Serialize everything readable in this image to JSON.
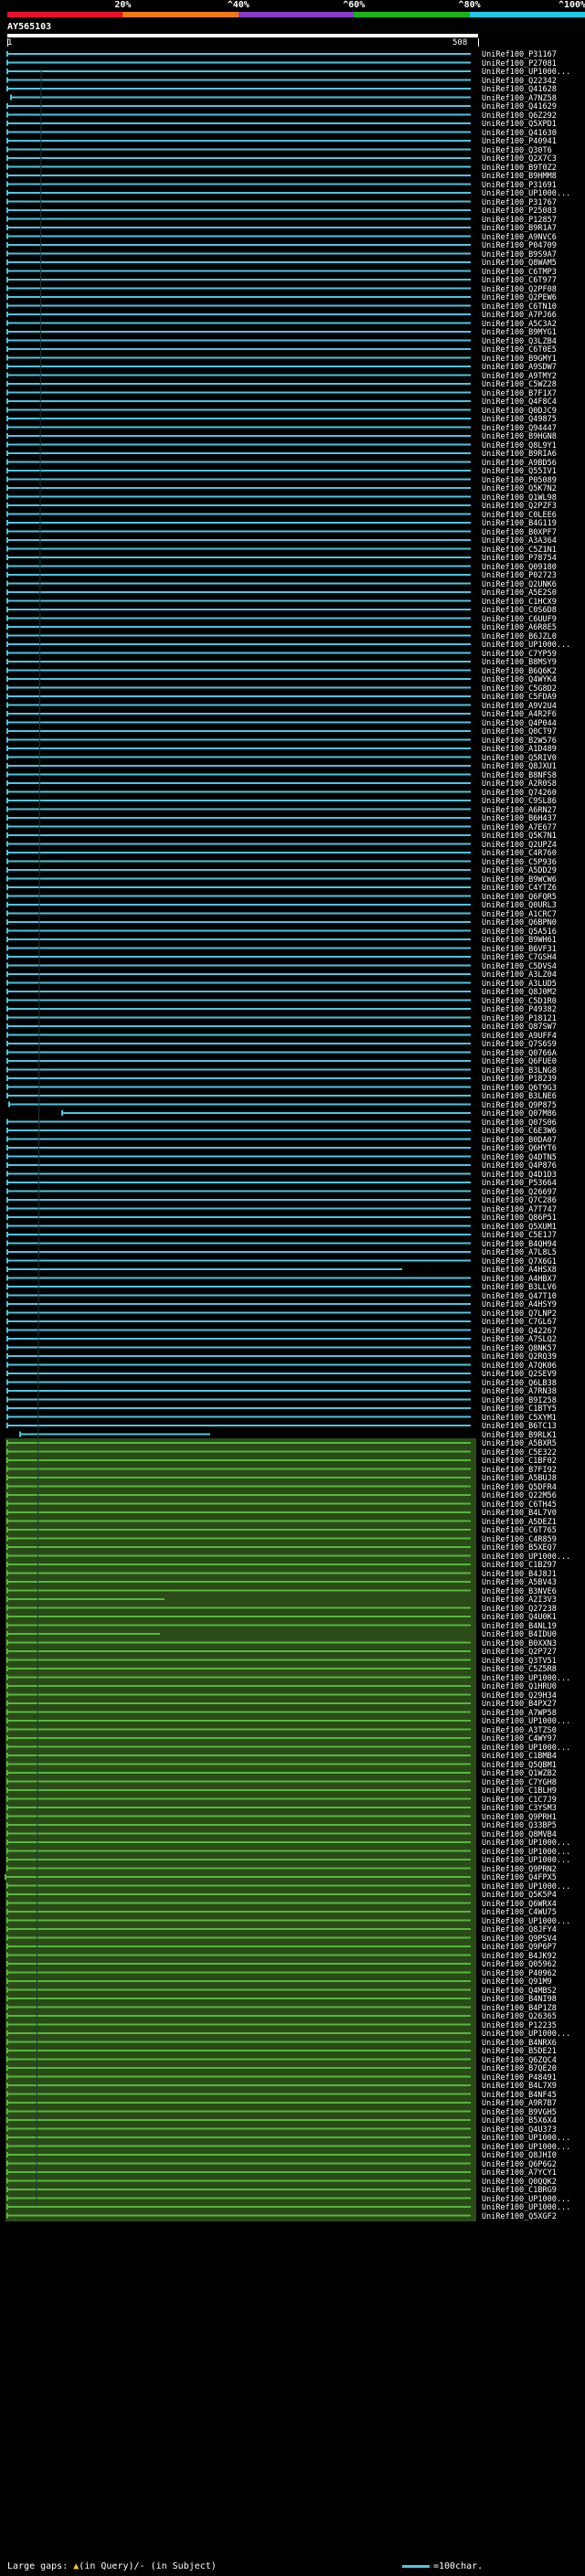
{
  "legend": {
    "labels": [
      "20%",
      "^40%",
      "^60%",
      "^80%",
      "^100%"
    ],
    "colors": [
      "#e8102a",
      "#f07a10",
      "#8a3cc8",
      "#18b418",
      "#1ec8e6"
    ]
  },
  "query": {
    "title": "AY565103",
    "ruler_start": "1",
    "ruler_end": "508"
  },
  "colors": {
    "cyan_hit": "#4ac6e0",
    "green_hit": "#56b83c",
    "green_bg": "#2a4a18",
    "gap_mark": "#ffd000"
  },
  "hits": [
    "UniRef100_P31167",
    "UniRef100_P27081",
    "UniRef100_UP1000...",
    "UniRef100_Q22342",
    "UniRef100_Q41628",
    "UniRef100_A7NZ58",
    "UniRef100_Q41629",
    "UniRef100_Q6Z292",
    "UniRef100_Q5XPD1",
    "UniRef100_Q41630",
    "UniRef100_P40941",
    "UniRef100_Q30T6",
    "UniRef100_Q2X7C3",
    "UniRef100_B9T0Z2",
    "UniRef100_B9HMM8",
    "UniRef100_P31691",
    "UniRef100_UP1000...",
    "UniRef100_P31767",
    "UniRef100_P25083",
    "UniRef100_P12857",
    "UniRef100_B9R1A7",
    "UniRef100_A9NVC6",
    "UniRef100_P04709",
    "UniRef100_B9S9A7",
    "UniRef100_Q8WAM5",
    "UniRef100_C6TMP3",
    "UniRef100_C6T977",
    "UniRef100_Q2PF08",
    "UniRef100_Q2PEW6",
    "UniRef100_C6TN10",
    "UniRef100_A7PJ66",
    "UniRef100_A5C3A2",
    "UniRef100_B9MYG1",
    "UniRef100_Q3LZB4",
    "UniRef100_C6T0E5",
    "UniRef100_B9GMY1",
    "UniRef100_A9SDW7",
    "UniRef100_A9TMY2",
    "UniRef100_C5WZ28",
    "UniRef100_B7F1X7",
    "UniRef100_Q4F8C4",
    "UniRef100_Q0DJC9",
    "UniRef100_Q49875",
    "UniRef100_Q94447",
    "UniRef100_B9HGN8",
    "UniRef100_Q8L9Y1",
    "UniRef100_B9RIA6",
    "UniRef100_A9BD56",
    "UniRef100_Q55IV1",
    "UniRef100_P05089",
    "UniRef100_Q5K7N2",
    "UniRef100_Q1WL98",
    "UniRef100_Q2PZF3",
    "UniRef100_C0LEE6",
    "UniRef100_B4G119",
    "UniRef100_B0XPF7",
    "UniRef100_A3A364",
    "UniRef100_C5Z1N1",
    "UniRef100_P78754",
    "UniRef100_Q09180",
    "UniRef100_P02723",
    "UniRef100_Q2UNK6",
    "UniRef100_A5E2S0",
    "UniRef100_C1HCX9",
    "UniRef100_C0S6D8",
    "UniRef100_C6UUF9",
    "UniRef100_A6R8E5",
    "UniRef100_B6JZL0",
    "UniRef100_UP1000...",
    "UniRef100_C7YP59",
    "UniRef100_B8MSY9",
    "UniRef100_B6Q6K2",
    "UniRef100_Q4WYK4",
    "UniRef100_C5G8D2",
    "UniRef100_C5FDA9",
    "UniRef100_A9V2U4",
    "UniRef100_A4R2F6",
    "UniRef100_Q4P044",
    "UniRef100_Q0CT97",
    "UniRef100_B2W576",
    "UniRef100_A1D489",
    "UniRef100_Q5RIV0",
    "UniRef100_Q8JXU1",
    "UniRef100_B8NFS8",
    "UniRef100_A2R0S8",
    "UniRef100_Q74260",
    "UniRef100_C9SL86",
    "UniRef100_A6RN27",
    "UniRef100_B6H437",
    "UniRef100_A7E677",
    "UniRef100_Q5K7N1",
    "UniRef100_Q2UPZ4",
    "UniRef100_C4R760",
    "UniRef100_C5P936",
    "UniRef100_A5DD29",
    "UniRef100_B9WCW6",
    "UniRef100_C4YTZ6",
    "UniRef100_Q6FQR5",
    "UniRef100_Q0URL3",
    "UniRef100_A1CRC7",
    "UniRef100_Q6BPN0",
    "UniRef100_Q5A516",
    "UniRef100_B9WH61",
    "UniRef100_B6VF31",
    "UniRef100_C7GSH4",
    "UniRef100_C5DVS4",
    "UniRef100_A3LZ04",
    "UniRef100_A3LUD5",
    "UniRef100_Q8J0M2",
    "UniRef100_C5D1R0",
    "UniRef100_P49382",
    "UniRef100_P18121",
    "UniRef100_Q87SW7",
    "UniRef100_A9UFF4",
    "UniRef100_Q7S6S9",
    "UniRef100_Q0766A",
    "UniRef100_Q6FUE0",
    "UniRef100_B3LNG8",
    "UniRef100_P18239",
    "UniRef100_Q6T9G3",
    "UniRef100_B3LNE6",
    "UniRef100_Q9P875",
    "UniRef100_Q07M86",
    "UniRef100_Q07S06",
    "UniRef100_C6E3W6",
    "UniRef100_B0DA07",
    "UniRef100_Q6HYT6",
    "UniRef100_Q4DTN5",
    "UniRef100_Q4P876",
    "UniRef100_Q4D1D3",
    "UniRef100_P53664",
    "UniRef100_Q26697",
    "UniRef100_Q7C286",
    "UniRef100_A7T747",
    "UniRef100_Q86P51",
    "UniRef100_Q5XUM1",
    "UniRef100_C5E1J7",
    "UniRef100_B4QH94",
    "UniRef100_A7L8L5",
    "UniRef100_Q7X6G1",
    "UniRef100_A4HSX8",
    "UniRef100_A4HBX7",
    "UniRef100_B3LLV6",
    "UniRef100_Q47T10",
    "UniRef100_A4HSY9",
    "UniRef100_Q7LNP2",
    "UniRef100_C7GL67",
    "UniRef100_Q42267",
    "UniRef100_A7SLQ2",
    "UniRef100_Q8NK57",
    "UniRef100_Q2RQ39",
    "UniRef100_A7QK06",
    "UniRef100_Q2SEV9",
    "UniRef100_Q6LB38",
    "UniRef100_A7RN38",
    "UniRef100_B9I258",
    "UniRef100_C1BTY5",
    "UniRef100_C5XYM1",
    "UniRef100_B6TC13",
    "UniRef100_B9RLK1",
    "UniRef100_A5BXR5",
    "UniRef100_C5E322",
    "UniRef100_C1BF02",
    "UniRef100_B7FI92",
    "UniRef100_A5BUJ8",
    "UniRef100_Q5DFR4",
    "UniRef100_Q22M56",
    "UniRef100_C6TH45",
    "UniRef100_B4L7V0",
    "UniRef100_A5DEZ1",
    "UniRef100_C6T765",
    "UniRef100_C4R859",
    "UniRef100_B5XEQ7",
    "UniRef100_UP1000...",
    "UniRef100_C1BZ97",
    "UniRef100_B4J8J1",
    "UniRef100_A5BV43",
    "UniRef100_B3NVE6",
    "UniRef100_A2I3V3",
    "UniRef100_Q27238",
    "UniRef100_Q4U0K1",
    "UniRef100_B4NL19",
    "UniRef100_B4IDU0",
    "UniRef100_B0XXN3",
    "UniRef100_Q2P727",
    "UniRef100_Q3TV51",
    "UniRef100_C5Z5R8",
    "UniRef100_UP1000...",
    "UniRef100_Q1HRU0",
    "UniRef100_Q29H34",
    "UniRef100_B4PX27",
    "UniRef100_A7WP58",
    "UniRef100_UP1000...",
    "UniRef100_A3TZS0",
    "UniRef100_C4WY97",
    "UniRef100_UP1000...",
    "UniRef100_C1BMB4",
    "UniRef100_Q5QBM1",
    "UniRef100_Q1WZB2",
    "UniRef100_C7YGH8",
    "UniRef100_C1BLH9",
    "UniRef100_C1C7J9",
    "UniRef100_C3YSM3",
    "UniRef100_Q9PRH1",
    "UniRef100_Q33BP5",
    "UniRef100_Q8MVB4",
    "UniRef100_UP1000...",
    "UniRef100_UP1000...",
    "UniRef100_UP1000...",
    "UniRef100_Q9PRN2",
    "UniRef100_Q4FPX5",
    "UniRef100_UP1000...",
    "UniRef100_Q5K5P4",
    "UniRef100_Q6WRX4",
    "UniRef100_C4WU75",
    "UniRef100_UP1000...",
    "UniRef100_Q8JFY4",
    "UniRef100_Q9PSV4",
    "UniRef100_Q9P6P7",
    "UniRef100_B4JK92",
    "UniRef100_Q05962",
    "UniRef100_P40962",
    "UniRef100_Q91M9",
    "UniRef100_Q4MBS2",
    "UniRef100_B4NI98",
    "UniRef100_B4P1Z8",
    "UniRef100_Q26365",
    "UniRef100_P12235",
    "UniRef100_UP1000...",
    "UniRef100_B4NRX6",
    "UniRef100_B5DE21",
    "UniRef100_Q6ZQC4",
    "UniRef100_B7QE20",
    "UniRef100_P48491",
    "UniRef100_B4L7X9",
    "UniRef100_B4NF45",
    "UniRef100_A9R7B7",
    "UniRef100_B9VGH5",
    "UniRef100_B5X6X4",
    "UniRef100_Q4U373",
    "UniRef100_UP1000...",
    "UniRef100_UP1000...",
    "UniRef100_Q8JHI0",
    "UniRef100_Q6P6G2",
    "UniRef100_A7YCY1",
    "UniRef100_Q0QQK2",
    "UniRef100_C1BRG9",
    "UniRef100_UP1000...",
    "UniRef100_UP1000...",
    "UniRef100_Q5XGF2"
  ],
  "footer": {
    "gaps_prefix": "Large gaps:",
    "gap_query": "(in Query)",
    "gap_subject": "/- (in Subject)",
    "scale_label": "=100char."
  }
}
